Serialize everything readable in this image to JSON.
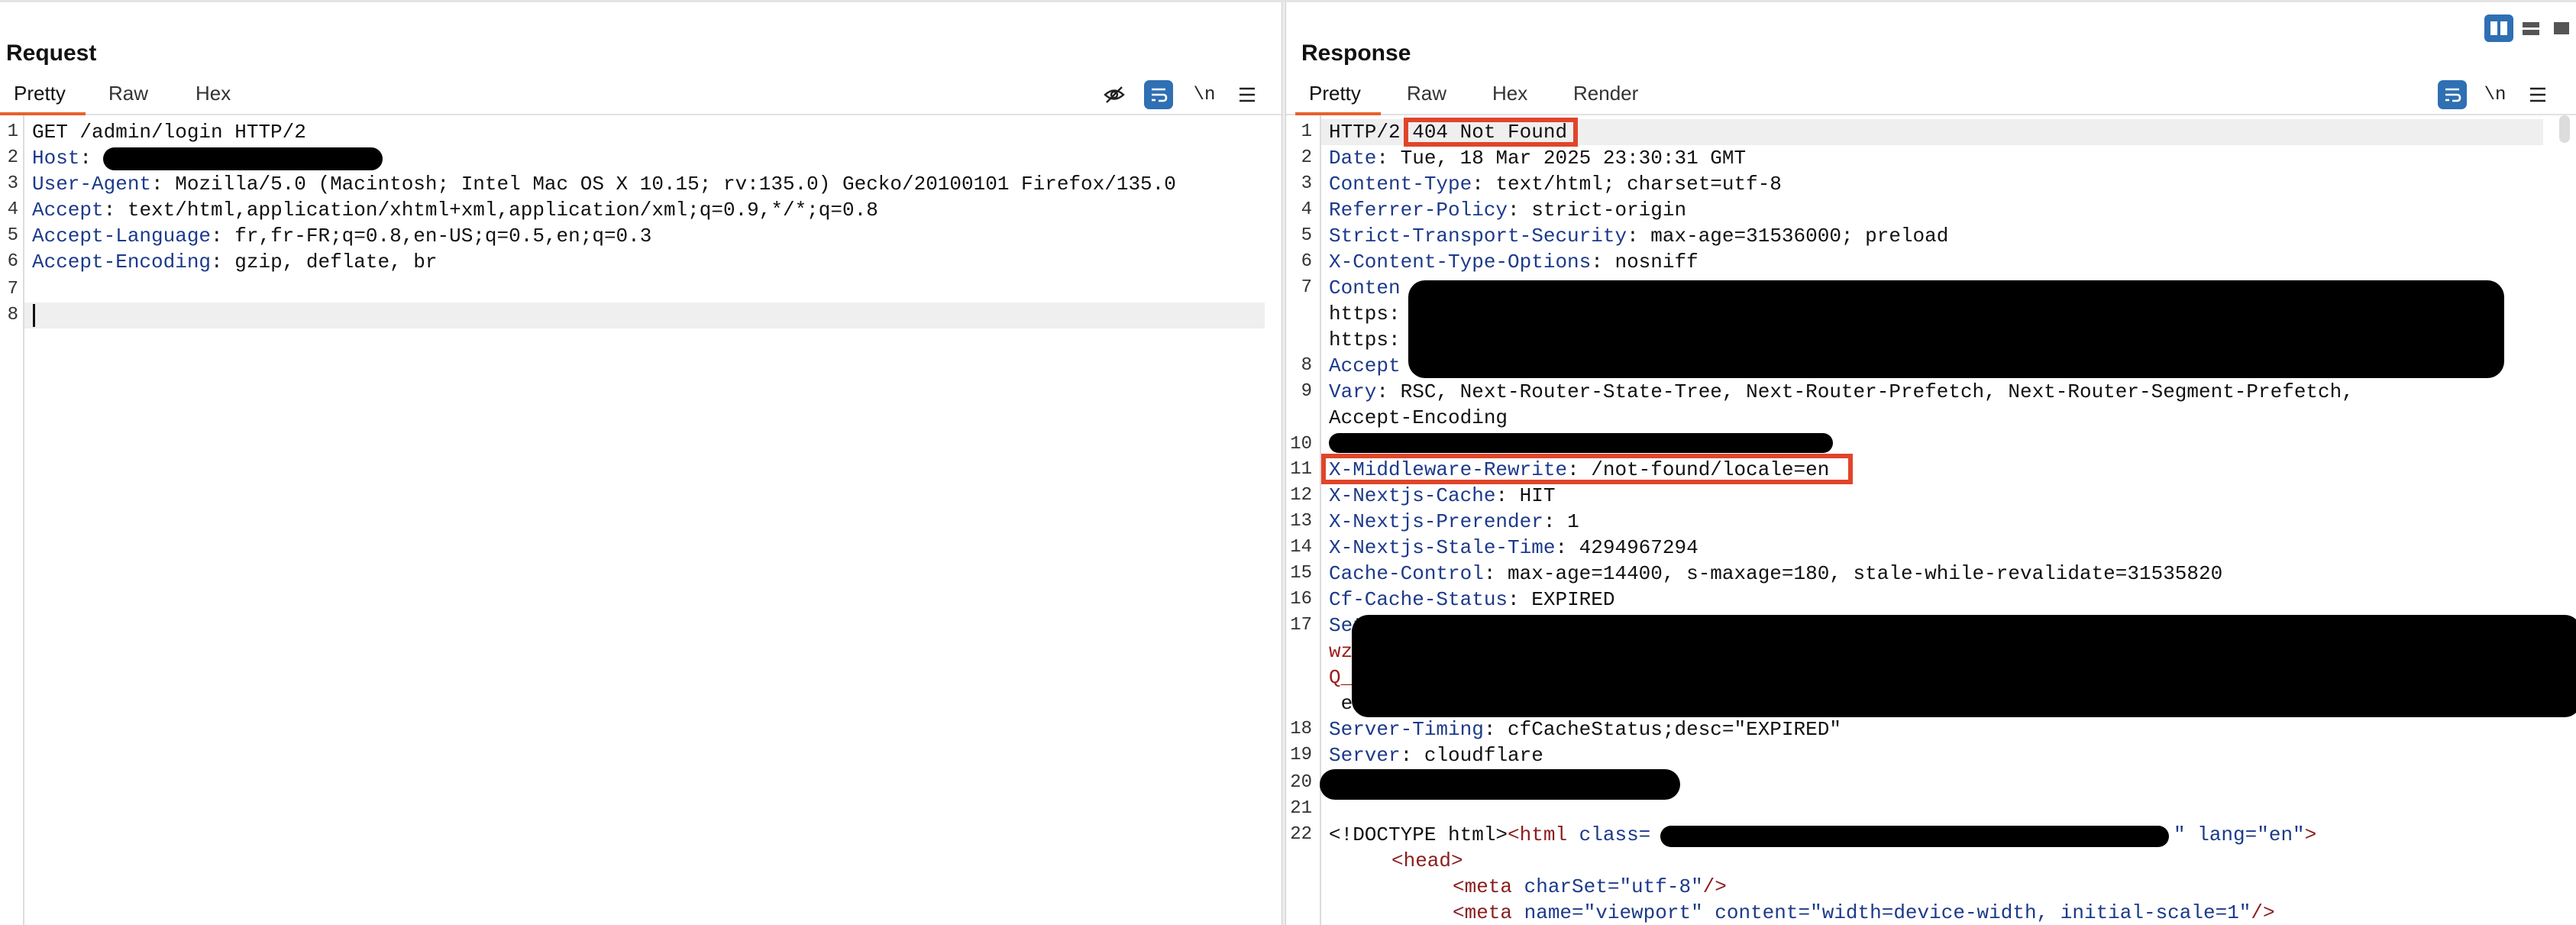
{
  "layout_switch": {
    "icons": [
      "split-vertical-icon",
      "split-horizontal-icon",
      "single-pane-icon"
    ],
    "active": 0
  },
  "request": {
    "title": "Request",
    "tabs": [
      "Pretty",
      "Raw",
      "Hex"
    ],
    "active_tab": "Pretty",
    "toolbar": {
      "newline_label": "\\n"
    },
    "lines": [
      {
        "n": "1",
        "key": "",
        "sep": "",
        "val": "GET /admin/login HTTP/2"
      },
      {
        "n": "2",
        "key": "Host",
        "sep": ":",
        "val": ""
      },
      {
        "n": "3",
        "key": "User-Agent",
        "sep": ":",
        "val": " Mozilla/5.0 (Macintosh; Intel Mac OS X 10.15; rv:135.0) Gecko/20100101 Firefox/135.0"
      },
      {
        "n": "4",
        "key": "Accept",
        "sep": ":",
        "val": " text/html,application/xhtml+xml,application/xml;q=0.9,*/*;q=0.8"
      },
      {
        "n": "5",
        "key": "Accept-Language",
        "sep": ":",
        "val": " fr,fr-FR;q=0.8,en-US;q=0.5,en;q=0.3"
      },
      {
        "n": "6",
        "key": "Accept-Encoding",
        "sep": ":",
        "val": " gzip, deflate, br"
      },
      {
        "n": "7",
        "key": "",
        "sep": "",
        "val": ""
      },
      {
        "n": "8",
        "key": "",
        "sep": "",
        "val": ""
      }
    ]
  },
  "response": {
    "title": "Response",
    "tabs": [
      "Pretty",
      "Raw",
      "Hex",
      "Render"
    ],
    "active_tab": "Pretty",
    "toolbar": {
      "newline_label": "\\n"
    },
    "status_prefix": "HTTP/2 ",
    "status_text": "404 Not Found",
    "headers": [
      {
        "n": "2",
        "key": "Date",
        "val": " Tue, 18 Mar 2025 23:30:31 GMT"
      },
      {
        "n": "3",
        "key": "Content-Type",
        "val": " text/html; charset=utf-8"
      },
      {
        "n": "4",
        "key": "Referrer-Policy",
        "val": " strict-origin"
      },
      {
        "n": "5",
        "key": "Strict-Transport-Security",
        "val": " max-age=31536000; preload"
      },
      {
        "n": "6",
        "key": "X-Content-Type-Options",
        "val": " nosniff"
      }
    ],
    "line7_frag": [
      "Conten",
      "https:",
      "https:"
    ],
    "line8_frag": "Accept",
    "vary_key": "Vary",
    "vary_val": " RSC, Next-Router-State-Tree, Next-Router-Prefetch, Next-Router-Segment-Prefetch,",
    "vary_cont": "Accept-Encoding",
    "rewrite_key": "X-Middleware-Rewrite",
    "rewrite_val": " /not-found/locale=en",
    "headers2": [
      {
        "n": "12",
        "key": "X-Nextjs-Cache",
        "val": " HIT"
      },
      {
        "n": "13",
        "key": "X-Nextjs-Prerender",
        "val": " 1"
      },
      {
        "n": "14",
        "key": "X-Nextjs-Stale-Time",
        "val": " 4294967294"
      },
      {
        "n": "15",
        "key": "Cache-Control",
        "val": " max-age=14400, s-maxage=180, stale-while-revalidate=31535820"
      },
      {
        "n": "16",
        "key": "Cf-Cache-Status",
        "val": " EXPIRED"
      }
    ],
    "line17_frag": [
      "Set",
      "wzl",
      "Q_",
      " ex"
    ],
    "headers3": [
      {
        "n": "18",
        "key": "Server-Timing",
        "val": " cfCacheStatus;desc=\"EXPIRED\""
      },
      {
        "n": "19",
        "key": "Server",
        "val": " cloudflare"
      }
    ],
    "doctype_line": {
      "doctype": "<!DOCTYPE html>",
      "html_open": "<html ",
      "class_attr": "class=",
      "quote_end": "\"",
      "lang_attr": " lang=",
      "lang_val": "\"en\"",
      "close": ">"
    },
    "head_tag": "<head>",
    "meta1": {
      "open": "<meta ",
      "attr": "charSet=",
      "val": "\"utf-8\"",
      "close": "/>"
    },
    "meta2": {
      "open": "<meta ",
      "attr1": "name=",
      "val1": "\"viewport\"",
      "attr2": " content=",
      "val2": "\"width=device-width, initial-scale=1\"",
      "close": "/>"
    }
  },
  "colors": {
    "accent_blue": "#2f6fb3",
    "tab_underline": "#e8612c",
    "highlight_box": "#e0452a",
    "header_key": "#1c3a8a"
  }
}
